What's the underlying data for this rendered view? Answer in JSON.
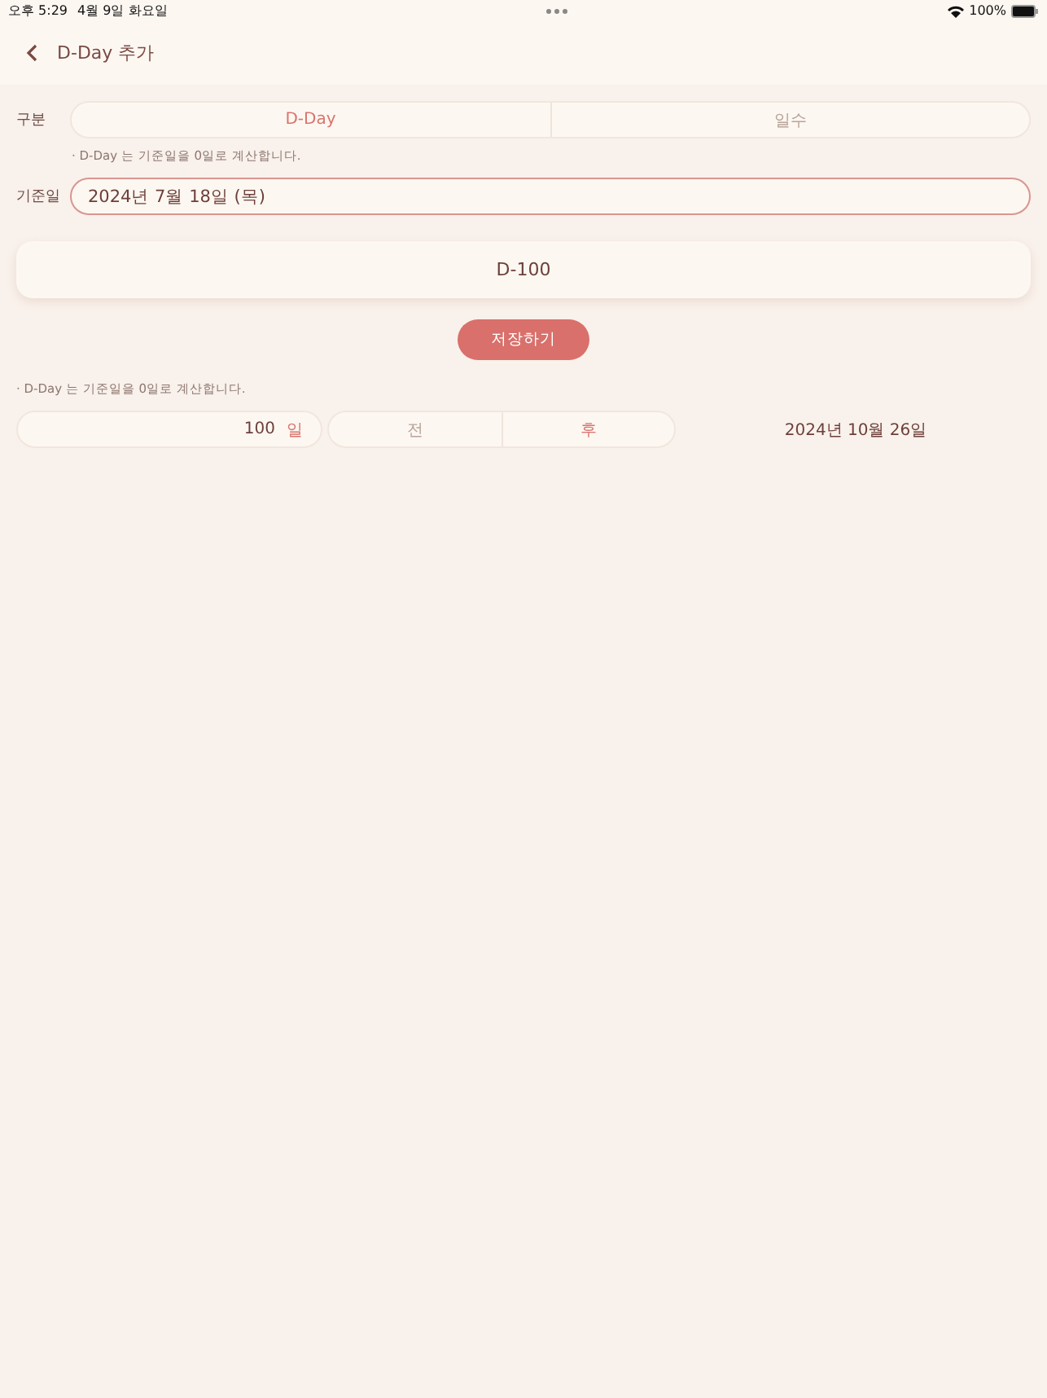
{
  "status_bar": {
    "time": "오후 5:29",
    "date": "4월 9일 화요일",
    "battery": "100%"
  },
  "header": {
    "title": "D-Day 추가"
  },
  "type_row": {
    "label": "구분",
    "options": [
      {
        "label": "D-Day",
        "selected": true
      },
      {
        "label": "일수",
        "selected": false
      }
    ]
  },
  "note_1": "· D-Day 는 기준일을 0일로 계산합니다.",
  "base_date": {
    "label": "기준일",
    "value": "2024년 7월 18일 (목)"
  },
  "result": "D-100",
  "save_button": "저장하기",
  "note_2": "· D-Day 는 기준일을 0일로 계산합니다.",
  "calculator": {
    "days": "100",
    "unit": "일",
    "directions": [
      {
        "label": "전",
        "selected": false
      },
      {
        "label": "후",
        "selected": true
      }
    ],
    "result_date": "2024년 10월 26일"
  }
}
